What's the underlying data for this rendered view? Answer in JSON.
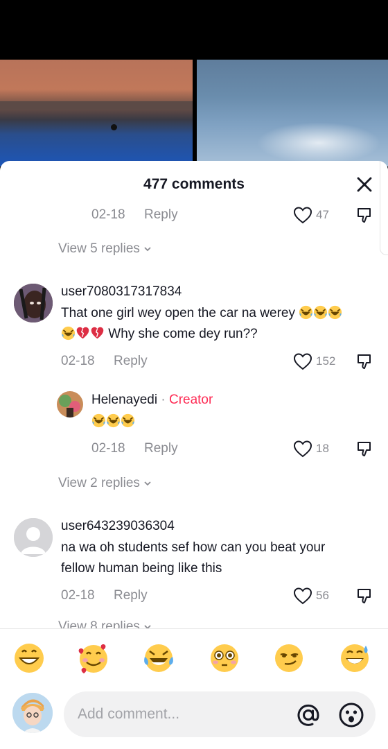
{
  "sheet": {
    "title": "477 comments"
  },
  "comments": [
    {
      "date": "02-18",
      "reply_label": "Reply",
      "likes": "47"
    },
    {
      "view_replies": "View 5 replies"
    },
    {
      "username": "user7080317317834",
      "text_line1": "That one girl wey open the car na werey",
      "text_line2": "Why she come dey run??",
      "date": "02-18",
      "reply_label": "Reply",
      "likes": "152"
    },
    {
      "username": "Helenayedi",
      "separator": " · ",
      "creator_label": "Creator",
      "date": "02-18",
      "reply_label": "Reply",
      "likes": "18"
    },
    {
      "view_replies": "View 2 replies"
    },
    {
      "username": "user643239036304",
      "text_line1": "na wa oh students sef how can you beat your",
      "text_line2": "fellow human being like this",
      "date": "02-18",
      "reply_label": "Reply",
      "likes": "56"
    },
    {
      "view_replies": "View 8 replies"
    }
  ],
  "emoji_bar": [
    "grinning-face",
    "smiling-face-with-hearts",
    "tears-of-joy",
    "flushed-face",
    "smirking-face",
    "grinning-sweat"
  ],
  "compose": {
    "placeholder": "Add comment..."
  },
  "colors": {
    "accent": "#fe2c55",
    "muted": "#8a8b91",
    "text": "#161823"
  }
}
